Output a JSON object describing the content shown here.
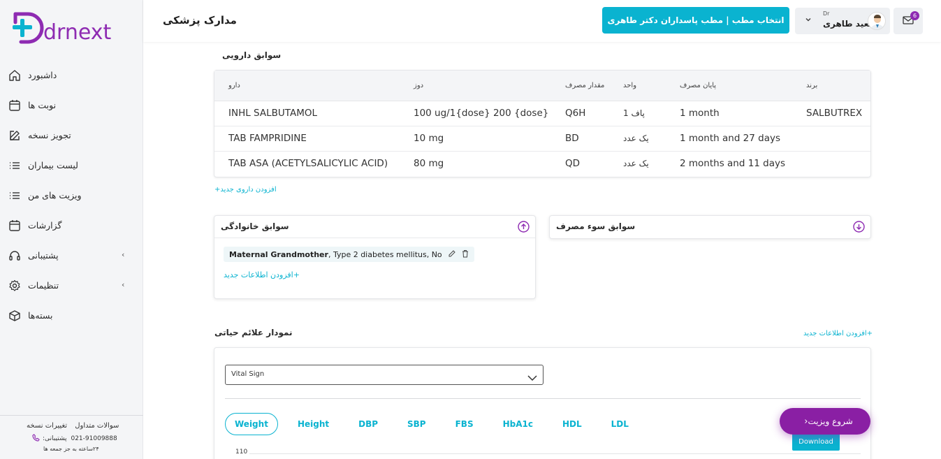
{
  "brand": {
    "logo_text": "drnext",
    "primary": "#0ab3d0",
    "accent": "#8e2bb2"
  },
  "sidebar": {
    "items": [
      {
        "label": "داشبورد",
        "icon": "home-icon"
      },
      {
        "label": "نوبت ها",
        "icon": "calendar-icon"
      },
      {
        "label": "تجویز نسخه",
        "icon": "edit-icon"
      },
      {
        "label": "لیست بیماران",
        "icon": "list-icon"
      },
      {
        "label": "ویزیت های من",
        "icon": "list-icon"
      },
      {
        "label": "گزارشات",
        "icon": "calendar-icon"
      },
      {
        "label": "پشتیبانی",
        "icon": "headset-icon",
        "chevron": "‹"
      },
      {
        "label": "تنظیمات",
        "icon": "gear-icon",
        "chevron": "‹"
      },
      {
        "label": "بسته‌ها",
        "icon": "package-icon"
      }
    ],
    "footer": {
      "faq": "سوالات متداول",
      "changelog": "تغییرات نسخه",
      "phone": "021-91009888",
      "support_label": ":پشتیبانی",
      "hours": "۲۴ساعته به جز جمعه ها"
    }
  },
  "header": {
    "title": "مدارک پزشکی",
    "clinic_button": "انتخاب مطب | مطب پاسداران دکتر طاهری",
    "user_prefix": "Dr",
    "user_name": "سعید طاهری",
    "mail_count": "6"
  },
  "drug_history": {
    "title": "سوابق دارویی",
    "columns": {
      "drug": "دارو",
      "dose": "دوز",
      "amount": "مقدار مصرف",
      "unit": "واحد",
      "end": "پایان مصرف",
      "brand": "برند"
    },
    "rows": [
      {
        "drug": "INHL SALBUTAMOL",
        "dose": "100 ug/1{dose} 200 {dose}",
        "amount": "Q6H",
        "unit": "پاف 1",
        "end": "1 month",
        "brand": "SALBUTREX"
      },
      {
        "drug": "TAB FAMPRIDINE",
        "dose": "10 mg",
        "amount": "BD",
        "unit": "یک عدد",
        "end": "1 month and 27 days",
        "brand": ""
      },
      {
        "drug": "TAB ASA (ACETYLSALICYLIC ACID)",
        "dose": "80 mg",
        "amount": "QD",
        "unit": "یک عدد",
        "end": "2 months and 11 days",
        "brand": ""
      }
    ],
    "add_link": "افزودن داروی جدید+"
  },
  "family_history": {
    "title": "سوابق خانوادگی",
    "entry_bold": "Maternal Grandmother",
    "entry_rest": ", Type 2 diabetes mellitus, No",
    "add_link": "+افزودن اطلاعات جدید"
  },
  "abuse_history": {
    "title": "سوابق سوء مصرف"
  },
  "vitals": {
    "title": "نمودار علائم حیاتی",
    "add_link": "+افزودن اطلاعات جدید",
    "select_value": "Vital Sign",
    "tabs": [
      "Weight",
      "Height",
      "DBP",
      "SBP",
      "FBS",
      "HbA1c",
      "HDL",
      "LDL"
    ],
    "active_tab": "Weight",
    "download": "Download",
    "y_tick": "110"
  },
  "start_visit": {
    "label": "شروع ویزیت",
    "chevron": "‹"
  }
}
